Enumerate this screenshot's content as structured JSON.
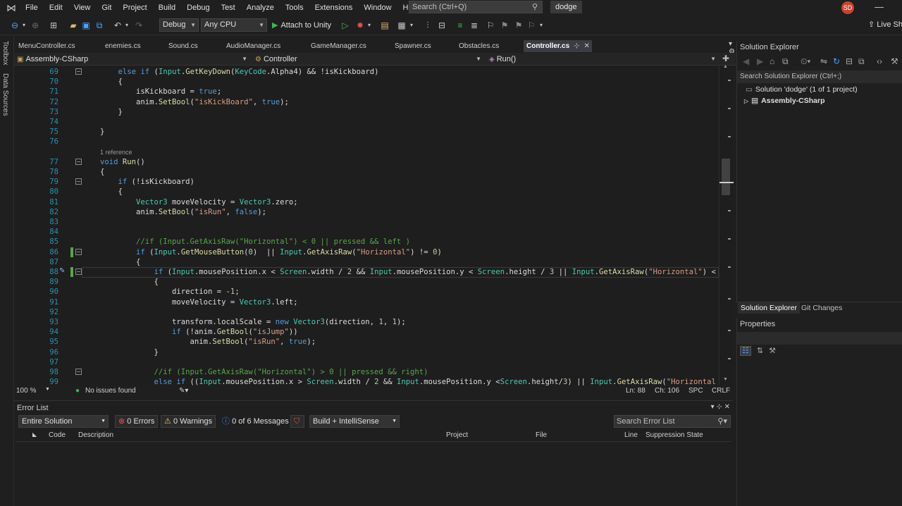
{
  "menubar": {
    "items": [
      "File",
      "Edit",
      "View",
      "Git",
      "Project",
      "Build",
      "Debug",
      "Test",
      "Analyze",
      "Tools",
      "Extensions",
      "Window",
      "Help"
    ],
    "search_placeholder": "Search (Ctrl+Q)",
    "solution_name": "dodge",
    "avatar_initials": "SD"
  },
  "toolbar": {
    "configuration": "Debug",
    "platform": "Any CPU",
    "attach_label": "Attach to Unity",
    "live_share": "Live Sh"
  },
  "left_strip": [
    "Toolbox",
    "Data Sources"
  ],
  "editor_tabs": [
    {
      "label": "MenuController.cs",
      "active": false
    },
    {
      "label": "enemies.cs",
      "active": false
    },
    {
      "label": "Sound.cs",
      "active": false
    },
    {
      "label": "AudioManager.cs",
      "active": false
    },
    {
      "label": "GameManager.cs",
      "active": false
    },
    {
      "label": "Spawner.cs",
      "active": false
    },
    {
      "label": "Obstacles.cs",
      "active": false
    },
    {
      "label": "Controller.cs",
      "active": true
    }
  ],
  "navbar": {
    "project": "Assembly-CSharp",
    "class": "Controller",
    "member": "Run()"
  },
  "code_lines": [
    {
      "n": "69",
      "text": "else if (Input.GetKeyDown(KeyCode.Alpha4) && !isKickboard)"
    },
    {
      "n": "70",
      "text": "{"
    },
    {
      "n": "71",
      "text": "isKickboard = true;"
    },
    {
      "n": "72",
      "text": "anim.SetBool(\"isKickBoard\", true);"
    },
    {
      "n": "73",
      "text": "}"
    },
    {
      "n": "74",
      "text": ""
    },
    {
      "n": "75",
      "text": "}"
    },
    {
      "n": "76",
      "text": ""
    },
    {
      "n": "",
      "text": "1 reference"
    },
    {
      "n": "77",
      "text": "void Run()"
    },
    {
      "n": "78",
      "text": "{"
    },
    {
      "n": "79",
      "text": "if (!isKickboard)"
    },
    {
      "n": "80",
      "text": "{"
    },
    {
      "n": "81",
      "text": "Vector3 moveVelocity = Vector3.zero;"
    },
    {
      "n": "82",
      "text": "anim.SetBool(\"isRun\", false);"
    },
    {
      "n": "83",
      "text": ""
    },
    {
      "n": "84",
      "text": ""
    },
    {
      "n": "85",
      "text": "//if (Input.GetAxisRaw(\"Horizontal\") < 0 || pressed && left )"
    },
    {
      "n": "86",
      "text": "if (Input.GetMouseButton(0)  || Input.GetAxisRaw(\"Horizontal\") != 0)"
    },
    {
      "n": "87",
      "text": "{"
    },
    {
      "n": "88",
      "text": "if (Input.mousePosition.x < Screen.width / 2 && Input.mousePosition.y < Screen.height / 3 || Input.GetAxisRaw(\"Horizontal\") <"
    },
    {
      "n": "89",
      "text": "{"
    },
    {
      "n": "90",
      "text": "direction = -1;"
    },
    {
      "n": "91",
      "text": "moveVelocity = Vector3.left;"
    },
    {
      "n": "92",
      "text": ""
    },
    {
      "n": "93",
      "text": "transform.localScale = new Vector3(direction, 1, 1);"
    },
    {
      "n": "94",
      "text": "if (!anim.GetBool(\"isJump\"))"
    },
    {
      "n": "95",
      "text": "anim.SetBool(\"isRun\", true);"
    },
    {
      "n": "96",
      "text": "}"
    },
    {
      "n": "97",
      "text": ""
    },
    {
      "n": "98",
      "text": "//if (Input.GetAxisRaw(\"Horizontal\") > 0 || pressed && right)"
    },
    {
      "n": "99",
      "text": "else if ((Input.mousePosition.x > Screen.width / 2 && Input.mousePosition.y <Screen.height/3) || Input.GetAxisRaw(\"Horizontal"
    }
  ],
  "editor_status": {
    "zoom": "100 %",
    "issues": "No issues found",
    "ln": "Ln: 88",
    "ch": "Ch: 106",
    "spc": "SPC",
    "crlf": "CRLF"
  },
  "error_list": {
    "title": "Error List",
    "scope": "Entire Solution",
    "errors": "0 Errors",
    "warnings": "0 Warnings",
    "messages": "0 of 6 Messages",
    "build_filter": "Build + IntelliSense",
    "search_placeholder": "Search Error List",
    "columns": [
      "Code",
      "Description",
      "Project",
      "File",
      "Line",
      "Suppression State"
    ]
  },
  "solution_explorer": {
    "title": "Solution Explorer",
    "search_placeholder": "Search Solution Explorer (Ctrl+;)",
    "solution_node": "Solution 'dodge' (1 of 1 project)",
    "project_node": "Assembly-CSharp",
    "tabs": [
      "Solution Explorer",
      "Git Changes"
    ]
  },
  "properties": {
    "title": "Properties"
  },
  "colors": {
    "background": "#1e1e1e",
    "keyword": "#569cd6",
    "type": "#4ec9b0",
    "string": "#d69d85",
    "comment": "#57a64a",
    "line_number": "#2b91af",
    "avatar": "#c8432f"
  }
}
